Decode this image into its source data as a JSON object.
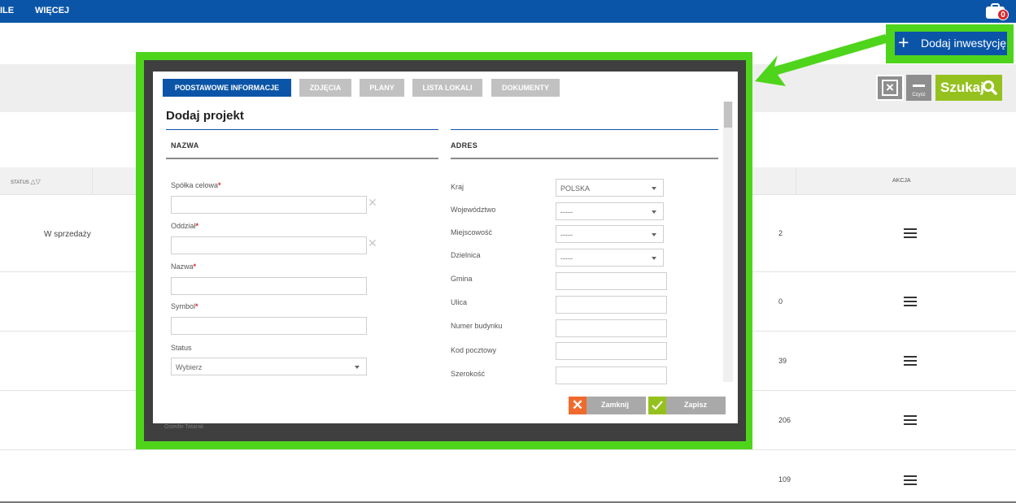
{
  "topbar": {
    "nav_left": "ILE",
    "nav_more": "WIĘCEJ",
    "cart_count": "0",
    "color": "#0b55a8"
  },
  "toolbar": {
    "add_label": "Dodaj inwestycję",
    "clear_label": "Czyść",
    "search_label": "Szukaj",
    "highlight_color": "#4fd41c"
  },
  "table": {
    "headers": {
      "status": "STATUS",
      "akcja": "AKCJA"
    },
    "rows": [
      {
        "status": "W sprzedaży",
        "count": "2"
      },
      {
        "status": "",
        "count": "0"
      },
      {
        "status": "",
        "count": "39"
      },
      {
        "status": "",
        "count": "206"
      },
      {
        "status": "",
        "count": "109"
      }
    ]
  },
  "modal": {
    "tabs": [
      {
        "label": "PODSTAWOWE INFORMACJE",
        "active": true
      },
      {
        "label": "ZDJĘCIA",
        "active": false
      },
      {
        "label": "PLANY",
        "active": false
      },
      {
        "label": "LISTA LOKALI",
        "active": false
      },
      {
        "label": "DOKUMENTY",
        "active": false
      }
    ],
    "title": "Dodaj projekt",
    "left_section": {
      "title": "NAZWA",
      "fields": {
        "spolka": "Spółka celowa",
        "oddzial": "Oddział",
        "nazwa": "Nazwa",
        "symbol": "Symbol",
        "status": "Status"
      },
      "required_mark": "*",
      "status_placeholder": "Wybierz"
    },
    "right_section": {
      "title": "ADRES",
      "fields": {
        "kraj": "Kraj",
        "wojewodztwo": "Województwo",
        "miejscowosc": "Miejscowość",
        "dzielnica": "Dzielnica",
        "gmina": "Gmina",
        "ulica": "Ulica",
        "numer": "Numer budynku",
        "kod": "Kod pocztowy",
        "szerokosc": "Szerokość"
      },
      "kraj_value": "POLSKA",
      "empty_select": "-----"
    },
    "buttons": {
      "close": "Zamknij",
      "save": "Zapisz"
    },
    "footer_text": "Osiedle Tatarak"
  }
}
